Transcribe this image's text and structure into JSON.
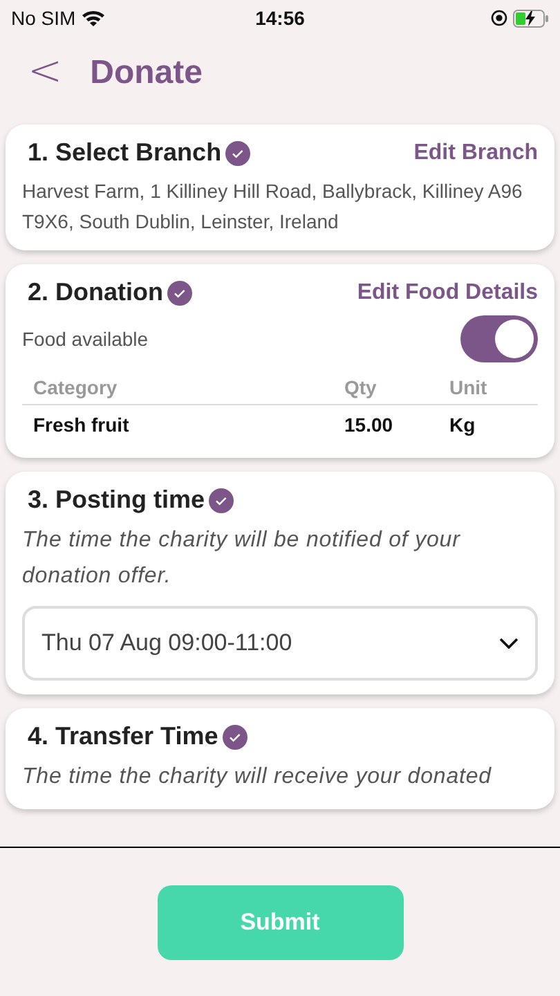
{
  "status_bar": {
    "carrier": "No SIM",
    "time": "14:56"
  },
  "header": {
    "back": "<",
    "title": "Donate"
  },
  "sections": [
    {
      "kind": "branch",
      "title": "1. Select Branch",
      "verified": true,
      "action": "Edit Branch",
      "address": "Harvest Farm, 1 Killiney Hill Road, Ballybrack, Killiney A96 T9X6, South Dublin, Leinster, Ireland"
    },
    {
      "kind": "donation",
      "title": "2. Donation",
      "verified": true,
      "action": "Edit Food Details",
      "toggle": {
        "label": "Food available",
        "on": true
      },
      "table": {
        "columns": [
          "Category",
          "Qty",
          "Unit"
        ],
        "rows": [
          [
            "Fresh fruit",
            "15.00",
            "Kg"
          ]
        ]
      }
    },
    {
      "kind": "time",
      "title": "3. Posting time",
      "verified": true,
      "description": "The time the charity will be notified of your donation offer.",
      "select": {
        "value": "Thu 07 Aug 09:00-11:00"
      }
    },
    {
      "kind": "time",
      "title": "4. Transfer Time",
      "verified": true,
      "description": "The time the charity will receive your donated"
    }
  ],
  "submit": "Submit"
}
